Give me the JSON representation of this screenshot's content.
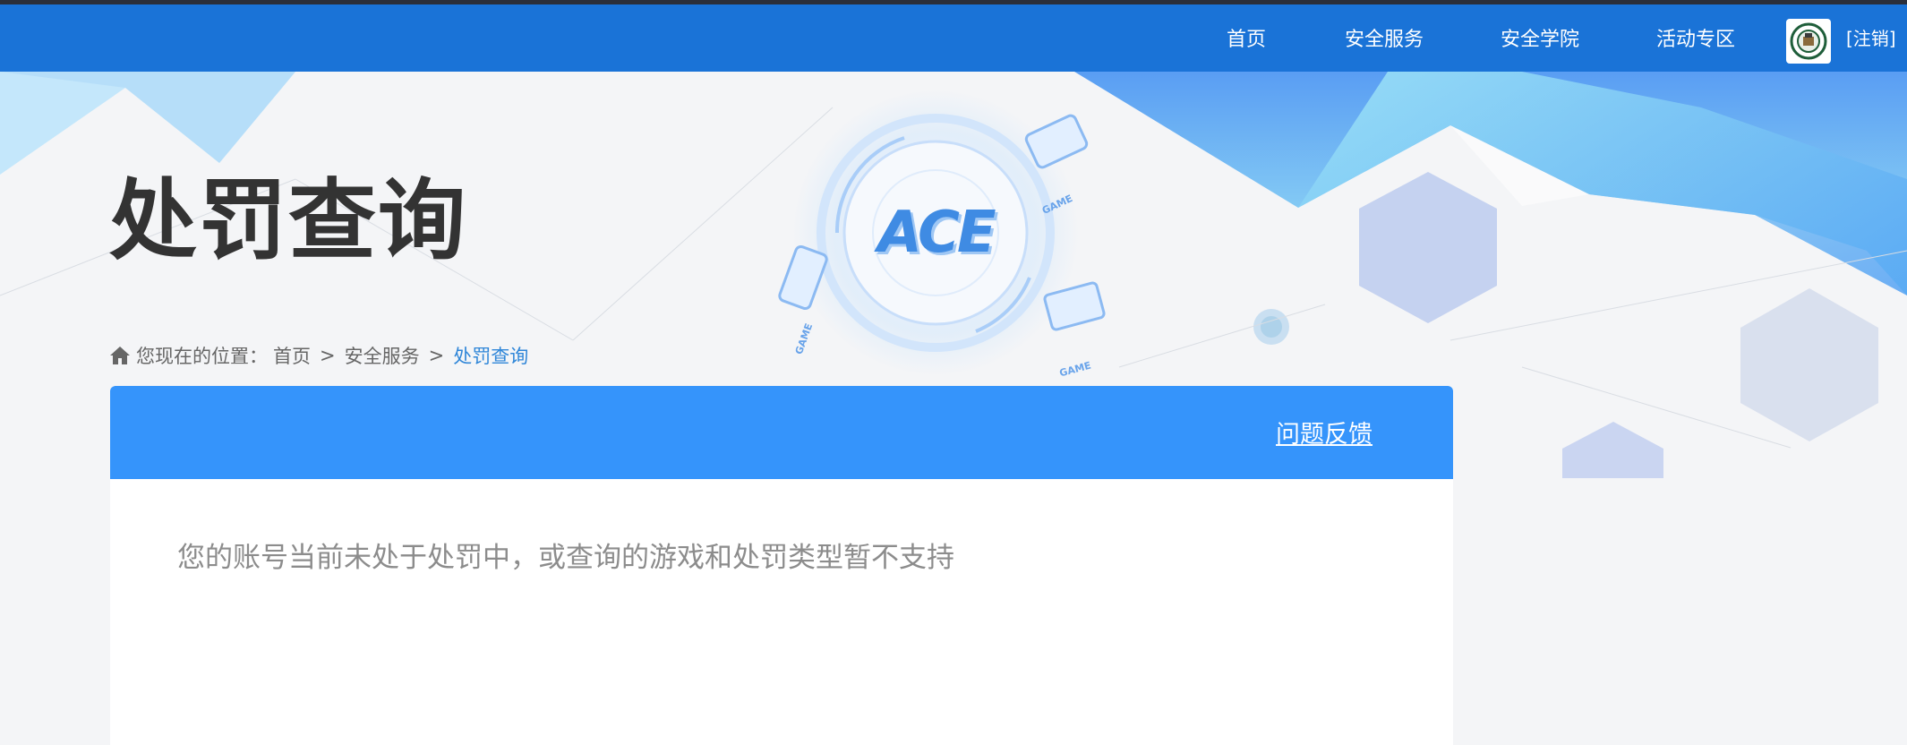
{
  "nav": {
    "items": [
      "首页",
      "安全服务",
      "安全学院",
      "活动专区"
    ],
    "logout": "[注销]"
  },
  "hero": {
    "title": "处罚查询",
    "logo_text": "ACE",
    "badge_text": "GAME"
  },
  "breadcrumb": {
    "prefix": "您现在的位置：",
    "items": [
      "首页",
      "安全服务",
      "处罚查询"
    ],
    "separator": ">"
  },
  "card": {
    "feedback_link": "问题反馈",
    "message": "您的账号当前未处于处罚中，或查询的游戏和处罚类型暂不支持"
  },
  "colors": {
    "nav_bg": "#1a73d7",
    "card_header": "#3594fb",
    "link_current": "#2f86d8"
  }
}
